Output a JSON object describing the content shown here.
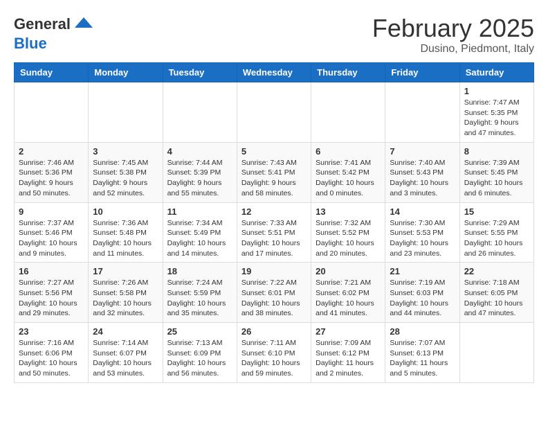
{
  "header": {
    "logo_general": "General",
    "logo_blue": "Blue",
    "month_title": "February 2025",
    "location": "Dusino, Piedmont, Italy"
  },
  "weekdays": [
    "Sunday",
    "Monday",
    "Tuesday",
    "Wednesday",
    "Thursday",
    "Friday",
    "Saturday"
  ],
  "weeks": [
    [
      {
        "day": "",
        "info": ""
      },
      {
        "day": "",
        "info": ""
      },
      {
        "day": "",
        "info": ""
      },
      {
        "day": "",
        "info": ""
      },
      {
        "day": "",
        "info": ""
      },
      {
        "day": "",
        "info": ""
      },
      {
        "day": "1",
        "info": "Sunrise: 7:47 AM\nSunset: 5:35 PM\nDaylight: 9 hours and 47 minutes."
      }
    ],
    [
      {
        "day": "2",
        "info": "Sunrise: 7:46 AM\nSunset: 5:36 PM\nDaylight: 9 hours and 50 minutes."
      },
      {
        "day": "3",
        "info": "Sunrise: 7:45 AM\nSunset: 5:38 PM\nDaylight: 9 hours and 52 minutes."
      },
      {
        "day": "4",
        "info": "Sunrise: 7:44 AM\nSunset: 5:39 PM\nDaylight: 9 hours and 55 minutes."
      },
      {
        "day": "5",
        "info": "Sunrise: 7:43 AM\nSunset: 5:41 PM\nDaylight: 9 hours and 58 minutes."
      },
      {
        "day": "6",
        "info": "Sunrise: 7:41 AM\nSunset: 5:42 PM\nDaylight: 10 hours and 0 minutes."
      },
      {
        "day": "7",
        "info": "Sunrise: 7:40 AM\nSunset: 5:43 PM\nDaylight: 10 hours and 3 minutes."
      },
      {
        "day": "8",
        "info": "Sunrise: 7:39 AM\nSunset: 5:45 PM\nDaylight: 10 hours and 6 minutes."
      }
    ],
    [
      {
        "day": "9",
        "info": "Sunrise: 7:37 AM\nSunset: 5:46 PM\nDaylight: 10 hours and 9 minutes."
      },
      {
        "day": "10",
        "info": "Sunrise: 7:36 AM\nSunset: 5:48 PM\nDaylight: 10 hours and 11 minutes."
      },
      {
        "day": "11",
        "info": "Sunrise: 7:34 AM\nSunset: 5:49 PM\nDaylight: 10 hours and 14 minutes."
      },
      {
        "day": "12",
        "info": "Sunrise: 7:33 AM\nSunset: 5:51 PM\nDaylight: 10 hours and 17 minutes."
      },
      {
        "day": "13",
        "info": "Sunrise: 7:32 AM\nSunset: 5:52 PM\nDaylight: 10 hours and 20 minutes."
      },
      {
        "day": "14",
        "info": "Sunrise: 7:30 AM\nSunset: 5:53 PM\nDaylight: 10 hours and 23 minutes."
      },
      {
        "day": "15",
        "info": "Sunrise: 7:29 AM\nSunset: 5:55 PM\nDaylight: 10 hours and 26 minutes."
      }
    ],
    [
      {
        "day": "16",
        "info": "Sunrise: 7:27 AM\nSunset: 5:56 PM\nDaylight: 10 hours and 29 minutes."
      },
      {
        "day": "17",
        "info": "Sunrise: 7:26 AM\nSunset: 5:58 PM\nDaylight: 10 hours and 32 minutes."
      },
      {
        "day": "18",
        "info": "Sunrise: 7:24 AM\nSunset: 5:59 PM\nDaylight: 10 hours and 35 minutes."
      },
      {
        "day": "19",
        "info": "Sunrise: 7:22 AM\nSunset: 6:01 PM\nDaylight: 10 hours and 38 minutes."
      },
      {
        "day": "20",
        "info": "Sunrise: 7:21 AM\nSunset: 6:02 PM\nDaylight: 10 hours and 41 minutes."
      },
      {
        "day": "21",
        "info": "Sunrise: 7:19 AM\nSunset: 6:03 PM\nDaylight: 10 hours and 44 minutes."
      },
      {
        "day": "22",
        "info": "Sunrise: 7:18 AM\nSunset: 6:05 PM\nDaylight: 10 hours and 47 minutes."
      }
    ],
    [
      {
        "day": "23",
        "info": "Sunrise: 7:16 AM\nSunset: 6:06 PM\nDaylight: 10 hours and 50 minutes."
      },
      {
        "day": "24",
        "info": "Sunrise: 7:14 AM\nSunset: 6:07 PM\nDaylight: 10 hours and 53 minutes."
      },
      {
        "day": "25",
        "info": "Sunrise: 7:13 AM\nSunset: 6:09 PM\nDaylight: 10 hours and 56 minutes."
      },
      {
        "day": "26",
        "info": "Sunrise: 7:11 AM\nSunset: 6:10 PM\nDaylight: 10 hours and 59 minutes."
      },
      {
        "day": "27",
        "info": "Sunrise: 7:09 AM\nSunset: 6:12 PM\nDaylight: 11 hours and 2 minutes."
      },
      {
        "day": "28",
        "info": "Sunrise: 7:07 AM\nSunset: 6:13 PM\nDaylight: 11 hours and 5 minutes."
      },
      {
        "day": "",
        "info": ""
      }
    ]
  ]
}
